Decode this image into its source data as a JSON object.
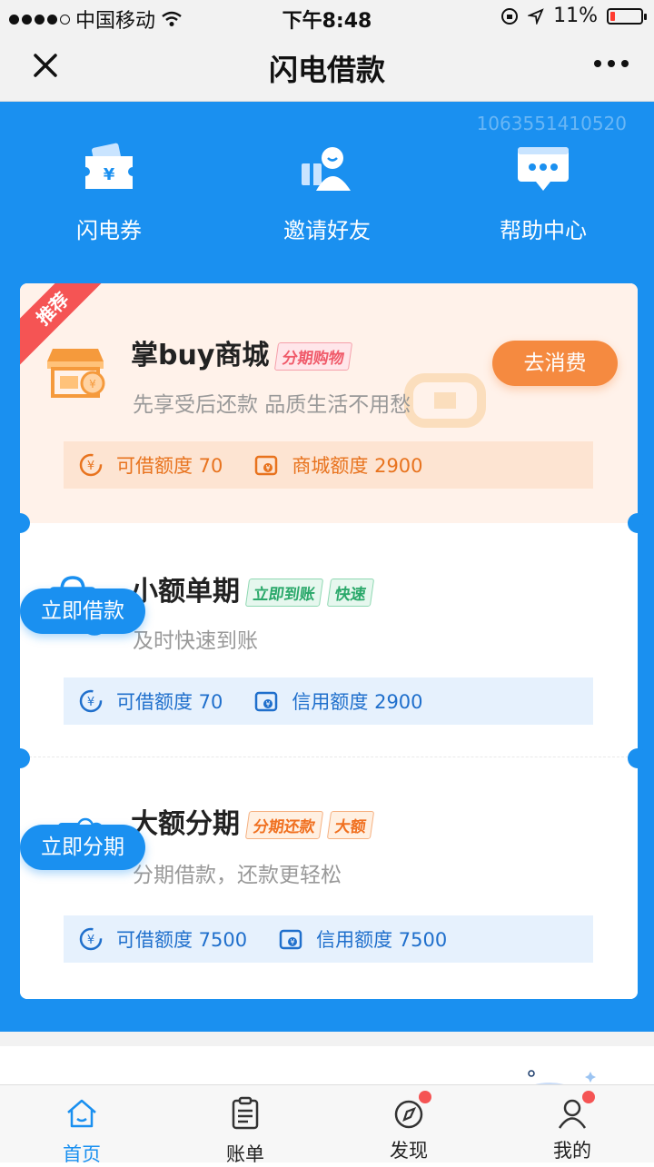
{
  "status_bar": {
    "carrier": "中国移动",
    "time": "下午8:48",
    "battery": "11%"
  },
  "navbar": {
    "title": "闪电借款",
    "close_icon": "close-icon",
    "more_icon": "more-icon"
  },
  "header": {
    "user_id": "1063551410520",
    "shortcuts": [
      {
        "label": "闪电券",
        "icon": "ticket-icon"
      },
      {
        "label": "邀请好友",
        "icon": "invite-friend-icon"
      },
      {
        "label": "帮助中心",
        "icon": "help-chat-icon"
      }
    ]
  },
  "products": [
    {
      "badge": "推荐",
      "name": "掌buy商城",
      "tags": [
        "分期购物"
      ],
      "desc": "先享受后还款 品质生活不用愁",
      "button": "去消费",
      "limits": [
        {
          "label": "可借额度 70"
        },
        {
          "label": "商城额度 2900"
        }
      ]
    },
    {
      "name": "小额单期",
      "tags": [
        "立即到账",
        "快速"
      ],
      "desc": "及时快速到账",
      "button": "立即借款",
      "limits": [
        {
          "label": "可借额度 70"
        },
        {
          "label": "信用额度 2900"
        }
      ]
    },
    {
      "name": "大额分期",
      "tags": [
        "分期还款",
        "大额"
      ],
      "desc": "分期借款，还款更轻松",
      "button": "立即分期",
      "limits": [
        {
          "label": "可借额度 7500"
        },
        {
          "label": "信用额度 7500"
        }
      ]
    }
  ],
  "tabbar": {
    "items": [
      {
        "label": "首页",
        "icon": "home-icon"
      },
      {
        "label": "账单",
        "icon": "bill-icon"
      },
      {
        "label": "发现",
        "icon": "compass-icon"
      },
      {
        "label": "我的",
        "icon": "user-icon"
      }
    ]
  },
  "colors": {
    "primary": "#1a90f0",
    "accent_orange": "#f58a40",
    "badge_red": "#f55454"
  }
}
